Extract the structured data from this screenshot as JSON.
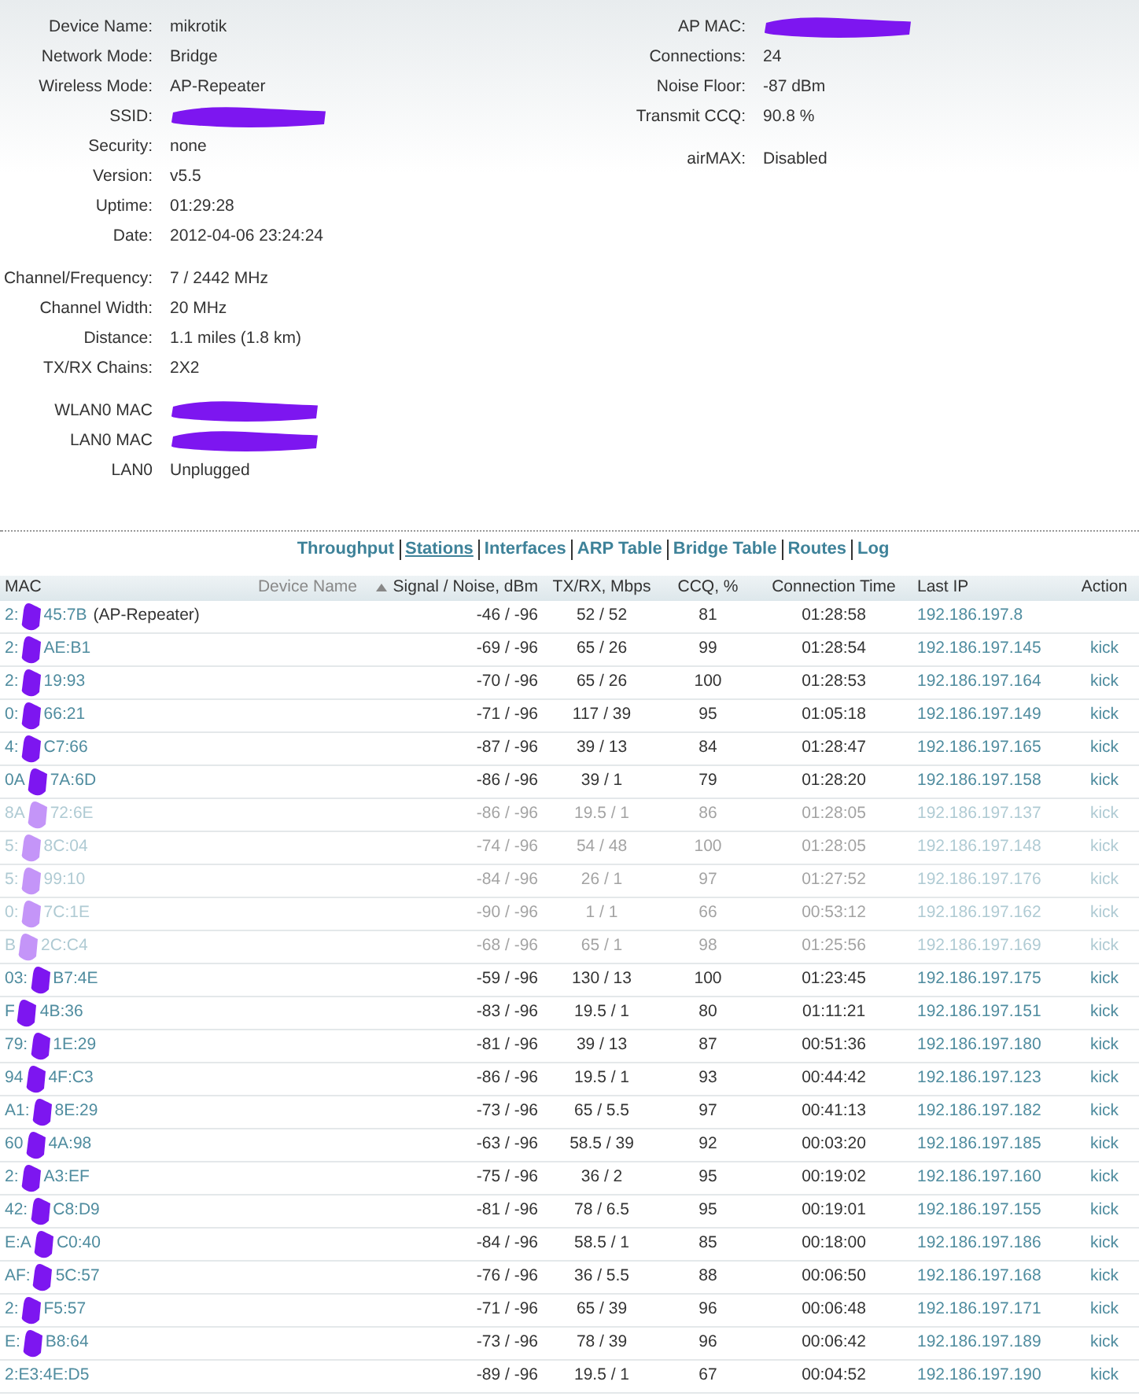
{
  "device_info": {
    "left_groups": [
      [
        {
          "label": "Device Name:",
          "value": "mikrotik"
        },
        {
          "label": "Network Mode:",
          "value": "Bridge"
        },
        {
          "label": "Wireless Mode:",
          "value": "AP-Repeater"
        },
        {
          "label": "SSID:",
          "redacted": true
        },
        {
          "label": "Security:",
          "value": "none"
        },
        {
          "label": "Version:",
          "value": "v5.5"
        },
        {
          "label": "Uptime:",
          "value": "01:29:28"
        },
        {
          "label": "Date:",
          "value": "2012-04-06 23:24:24"
        }
      ],
      [
        {
          "label": "Channel/Frequency:",
          "value": "7 / 2442 MHz"
        },
        {
          "label": "Channel Width:",
          "value": "20 MHz"
        },
        {
          "label": "Distance:",
          "value": "1.1 miles (1.8 km)"
        },
        {
          "label": "TX/RX Chains:",
          "value": "2X2"
        }
      ],
      [
        {
          "label": "WLAN0 MAC",
          "redacted": true
        },
        {
          "label": "LAN0 MAC",
          "redacted": true
        },
        {
          "label": "LAN0",
          "value": "Unplugged"
        }
      ]
    ],
    "right_groups": [
      [
        {
          "label": "AP MAC:",
          "redacted": true
        },
        {
          "label": "Connections:",
          "value": "24"
        },
        {
          "label": "Noise Floor:",
          "value": "-87 dBm"
        },
        {
          "label": "Transmit CCQ:",
          "value": "90.8 %"
        }
      ],
      [
        {
          "label": "airMAX:",
          "value": "Disabled"
        }
      ]
    ]
  },
  "nav": [
    {
      "label": "Throughput",
      "selected": false
    },
    {
      "label": "Stations",
      "selected": true
    },
    {
      "label": "Interfaces",
      "selected": false
    },
    {
      "label": "ARP Table",
      "selected": false
    },
    {
      "label": "Bridge Table",
      "selected": false
    },
    {
      "label": "Routes",
      "selected": false
    },
    {
      "label": "Log",
      "selected": false
    }
  ],
  "table": {
    "columns": [
      {
        "label": "MAC",
        "sorted": false
      },
      {
        "label": "Device Name",
        "sorted": false
      },
      {
        "label": "Signal / Noise, dBm",
        "sorted": true
      },
      {
        "label": "TX/RX, Mbps",
        "sorted": false
      },
      {
        "label": "CCQ, %",
        "sorted": false
      },
      {
        "label": "Connection Time",
        "sorted": false
      },
      {
        "label": "Last IP",
        "sorted": false
      },
      {
        "label": "Action",
        "sorted": false
      }
    ],
    "rows": [
      {
        "mac_start": "2:",
        "mac_end": "45:7B",
        "device": "(AP-Repeater)",
        "redacted": true,
        "faded": false,
        "signal": "-46 / -96",
        "txrx": "52 / 52",
        "ccq": "81",
        "time": "01:28:58",
        "ip": "192.186.197.8"
      },
      {
        "mac_start": "2:",
        "mac_end": "AE:B1",
        "redacted": true,
        "faded": false,
        "signal": "-69 / -96",
        "txrx": "65 / 26",
        "ccq": "99",
        "time": "01:28:54",
        "ip": "192.186.197.145",
        "action": "kick"
      },
      {
        "mac_start": "2:",
        "mac_end": "19:93",
        "redacted": true,
        "faded": false,
        "signal": "-70 / -96",
        "txrx": "65 / 26",
        "ccq": "100",
        "time": "01:28:53",
        "ip": "192.186.197.164",
        "action": "kick"
      },
      {
        "mac_start": "0:",
        "mac_end": "66:21",
        "redacted": true,
        "faded": false,
        "signal": "-71 / -96",
        "txrx": "117 / 39",
        "ccq": "95",
        "time": "01:05:18",
        "ip": "192.186.197.149",
        "action": "kick"
      },
      {
        "mac_start": "4:",
        "mac_end": "C7:66",
        "redacted": true,
        "faded": false,
        "signal": "-87 / -96",
        "txrx": "39 / 13",
        "ccq": "84",
        "time": "01:28:47",
        "ip": "192.186.197.165",
        "action": "kick"
      },
      {
        "mac_start": "0A",
        "mac_end": "7A:6D",
        "redacted": true,
        "faded": false,
        "signal": "-86 / -96",
        "txrx": "39 / 1",
        "ccq": "79",
        "time": "01:28:20",
        "ip": "192.186.197.158",
        "action": "kick"
      },
      {
        "mac_start": "8A",
        "mac_end": "72:6E",
        "redacted": true,
        "faded": true,
        "signal": "-86 / -96",
        "txrx": "19.5 / 1",
        "ccq": "86",
        "time": "01:28:05",
        "ip": "192.186.197.137",
        "action": "kick"
      },
      {
        "mac_start": "5:",
        "mac_end": "8C:04",
        "redacted": true,
        "faded": true,
        "signal": "-74 / -96",
        "txrx": "54 / 48",
        "ccq": "100",
        "time": "01:28:05",
        "ip": "192.186.197.148",
        "action": "kick"
      },
      {
        "mac_start": "5:",
        "mac_end": "99:10",
        "redacted": true,
        "faded": true,
        "signal": "-84 / -96",
        "txrx": "26 / 1",
        "ccq": "97",
        "time": "01:27:52",
        "ip": "192.186.197.176",
        "action": "kick"
      },
      {
        "mac_start": "0:",
        "mac_end": "7C:1E",
        "redacted": true,
        "faded": true,
        "signal": "-90 / -96",
        "txrx": "1 / 1",
        "ccq": "66",
        "time": "00:53:12",
        "ip": "192.186.197.162",
        "action": "kick"
      },
      {
        "mac_start": "B",
        "mac_end": "2C:C4",
        "redacted": true,
        "faded": true,
        "signal": "-68 / -96",
        "txrx": "65 / 1",
        "ccq": "98",
        "time": "01:25:56",
        "ip": "192.186.197.169",
        "action": "kick"
      },
      {
        "mac_start": "03:",
        "mac_end": "B7:4E",
        "redacted": true,
        "faded": false,
        "signal": "-59 / -96",
        "txrx": "130 / 13",
        "ccq": "100",
        "time": "01:23:45",
        "ip": "192.186.197.175",
        "action": "kick"
      },
      {
        "mac_start": "F",
        "mac_end": "4B:36",
        "redacted": true,
        "faded": false,
        "signal": "-83 / -96",
        "txrx": "19.5 / 1",
        "ccq": "80",
        "time": "01:11:21",
        "ip": "192.186.197.151",
        "action": "kick"
      },
      {
        "mac_start": "79:",
        "mac_end": "1E:29",
        "redacted": true,
        "faded": false,
        "signal": "-81 / -96",
        "txrx": "39 / 13",
        "ccq": "87",
        "time": "00:51:36",
        "ip": "192.186.197.180",
        "action": "kick"
      },
      {
        "mac_start": "94",
        "mac_end": "4F:C3",
        "redacted": true,
        "faded": false,
        "signal": "-86 / -96",
        "txrx": "19.5 / 1",
        "ccq": "93",
        "time": "00:44:42",
        "ip": "192.186.197.123",
        "action": "kick"
      },
      {
        "mac_start": "A1:",
        "mac_end": "8E:29",
        "redacted": true,
        "faded": false,
        "signal": "-73 / -96",
        "txrx": "65 / 5.5",
        "ccq": "97",
        "time": "00:41:13",
        "ip": "192.186.197.182",
        "action": "kick"
      },
      {
        "mac_start": "60",
        "mac_end": "4A:98",
        "redacted": true,
        "faded": false,
        "signal": "-63 / -96",
        "txrx": "58.5 / 39",
        "ccq": "92",
        "time": "00:03:20",
        "ip": "192.186.197.185",
        "action": "kick"
      },
      {
        "mac_start": "2:",
        "mac_end": "A3:EF",
        "redacted": true,
        "faded": false,
        "signal": "-75 / -96",
        "txrx": "36 / 2",
        "ccq": "95",
        "time": "00:19:02",
        "ip": "192.186.197.160",
        "action": "kick"
      },
      {
        "mac_start": "42:",
        "mac_end": "C8:D9",
        "redacted": true,
        "faded": false,
        "signal": "-81 / -96",
        "txrx": "78 / 6.5",
        "ccq": "95",
        "time": "00:19:01",
        "ip": "192.186.197.155",
        "action": "kick"
      },
      {
        "mac_start": "E:A",
        "mac_end": "C0:40",
        "redacted": true,
        "faded": false,
        "signal": "-84 / -96",
        "txrx": "58.5 / 1",
        "ccq": "85",
        "time": "00:18:00",
        "ip": "192.186.197.186",
        "action": "kick"
      },
      {
        "mac_start": "AF:",
        "mac_end": "5C:57",
        "redacted": true,
        "faded": false,
        "signal": "-76 / -96",
        "txrx": "36 / 5.5",
        "ccq": "88",
        "time": "00:06:50",
        "ip": "192.186.197.168",
        "action": "kick"
      },
      {
        "mac_start": "2:",
        "mac_end": "F5:57",
        "redacted": true,
        "faded": false,
        "signal": "-71 / -96",
        "txrx": "65 / 39",
        "ccq": "96",
        "time": "00:06:48",
        "ip": "192.186.197.171",
        "action": "kick"
      },
      {
        "mac_start": "E:",
        "mac_end": "B8:64",
        "redacted": true,
        "faded": false,
        "signal": "-73 / -96",
        "txrx": "78 / 39",
        "ccq": "96",
        "time": "00:06:42",
        "ip": "192.186.197.189",
        "action": "kick"
      },
      {
        "mac_start": "2:E3:4E:D5",
        "redacted": false,
        "faded": false,
        "signal": "-89 / -96",
        "txrx": "19.5 / 1",
        "ccq": "67",
        "time": "00:04:52",
        "ip": "192.186.197.190",
        "action": "kick"
      }
    ]
  }
}
